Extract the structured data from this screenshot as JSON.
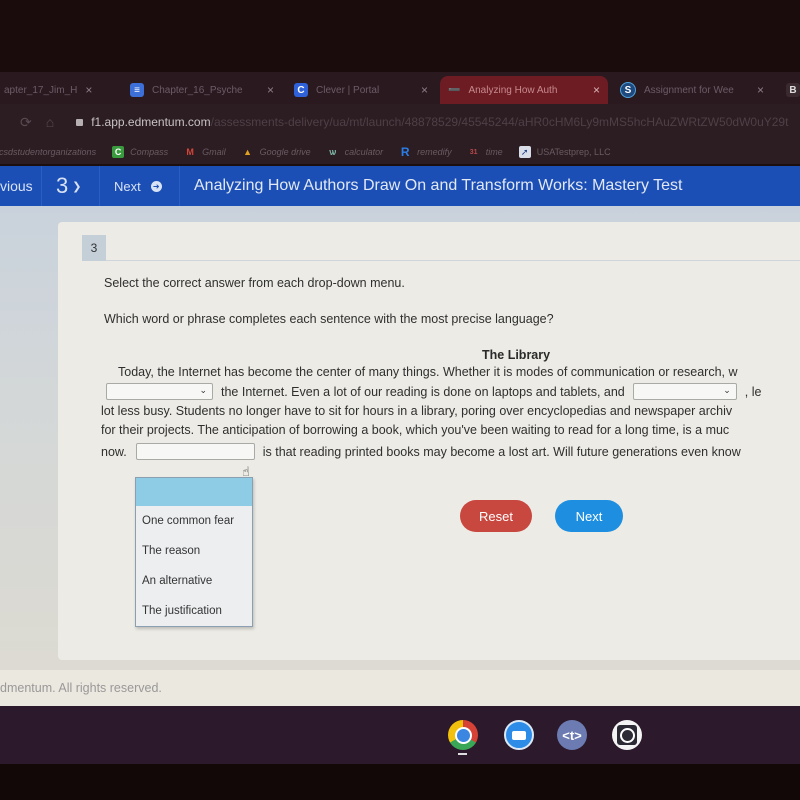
{
  "browser": {
    "tabs": [
      {
        "label": "apter_17_Jim_H",
        "icon": "doc-icon",
        "active": false
      },
      {
        "label": "Chapter_16_Psyche",
        "icon": "docs-icon",
        "active": false
      },
      {
        "label": "Clever | Portal",
        "icon": "clever-icon",
        "active": false
      },
      {
        "label": "Analyzing How Auth",
        "icon": "edmentum-icon",
        "active": true
      },
      {
        "label": "Assignment for Wee",
        "icon": "schoology-icon",
        "active": false
      },
      {
        "label": "B",
        "icon": "b-icon",
        "active": false
      }
    ],
    "url_host": "f1.app.edmentum.com",
    "url_path": "/assessments-delivery/ua/mt/launch/48878529/45545244/aHR0cHM6Ly9mMS5hcHAuZWRtZW50dW0uY29t",
    "bookmarks": [
      {
        "label": "ucsdstudentorganizations",
        "icon": ""
      },
      {
        "label": "Compass",
        "icon": "C"
      },
      {
        "label": "Gmail",
        "icon": "M"
      },
      {
        "label": "Google drive",
        "icon": "drive"
      },
      {
        "label": "calculator",
        "icon": "calc"
      },
      {
        "label": "remedify",
        "icon": "R"
      },
      {
        "label": "time",
        "icon": "31"
      },
      {
        "label": "USATestprep, LLC",
        "icon": "arrow"
      }
    ]
  },
  "header": {
    "previous_label": "vious",
    "question_number": "3",
    "next_label": "Next",
    "title": "Analyzing How Authors Draw On and Transform Works: Mastery Test"
  },
  "question": {
    "number": "3",
    "instruction": "Select the correct answer from each drop-down menu.",
    "prompt": "Which word or phrase completes each sentence with the most precise language?",
    "passage_title": "The Library",
    "lines": [
      "Today, the Internet has become the center of many things. Whether it is modes of communication or research, w",
      "the Internet. Even a lot of our reading is done on laptops and tablets, and",
      ", le",
      "lot less busy. Students no longer have to sit for hours in a library, poring over encyclopedias and newspaper archiv",
      "for their projects. The anticipation of borrowing a book, which you've been waiting to read for a long time, is a muc",
      "now.",
      "is that reading printed books may become a lost art. Will future generations even know"
    ],
    "dropdowns": [
      {
        "selected": "",
        "open": false
      },
      {
        "selected": "",
        "open": false
      },
      {
        "selected": "",
        "open": true
      }
    ],
    "open_menu_options": [
      "",
      "One common fear",
      "The reason",
      "An alternative",
      "The justification"
    ],
    "reset_label": "Reset",
    "next_label": "Next"
  },
  "footer": {
    "copyright": "dmentum. All rights reserved."
  },
  "shelf": {
    "apps": [
      "chrome",
      "zoom",
      "<t>",
      "screen-capture"
    ],
    "t_label": "<t>"
  },
  "colors": {
    "appbar": "#1b4fb5",
    "reset": "#c8473f",
    "next": "#1e8fe0",
    "menu_highlight": "#8ecbe4"
  }
}
